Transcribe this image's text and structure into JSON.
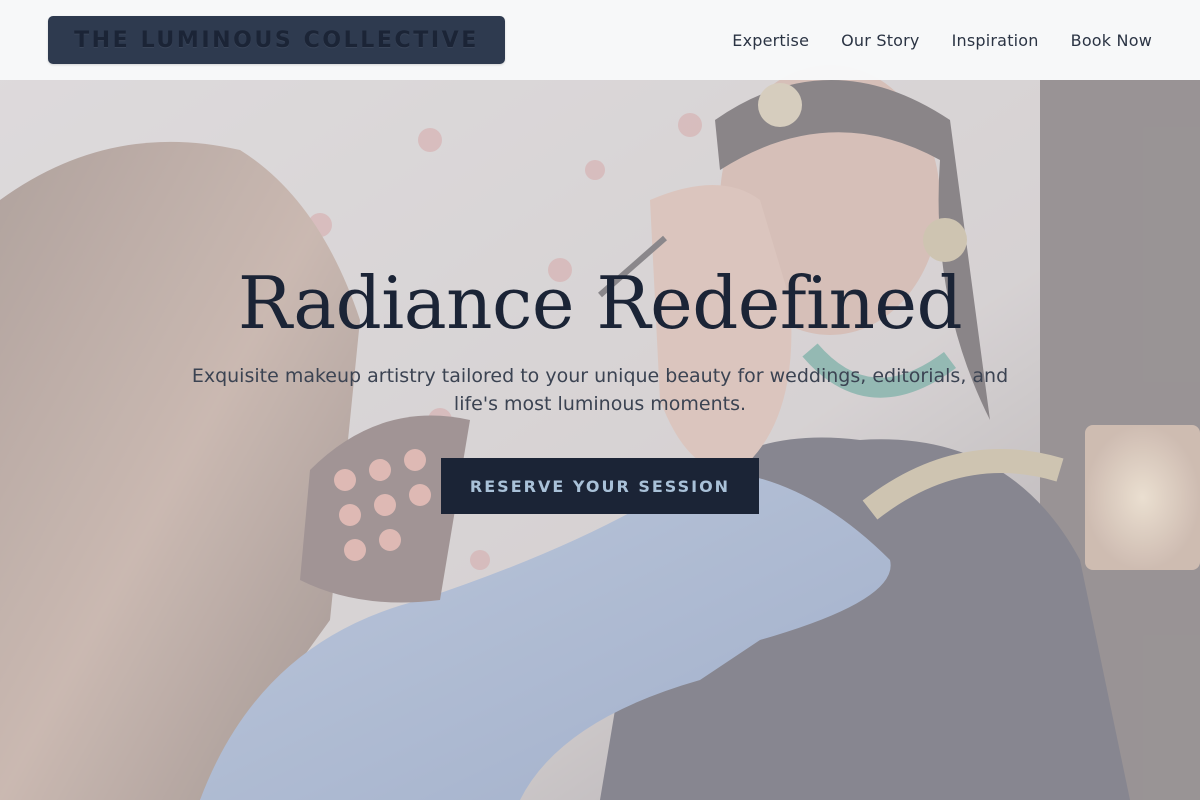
{
  "header": {
    "brand": "THE LUMINOUS COLLECTIVE",
    "nav": [
      {
        "label": "Expertise"
      },
      {
        "label": "Our Story"
      },
      {
        "label": "Inspiration"
      },
      {
        "label": "Book Now"
      }
    ]
  },
  "hero": {
    "title": "Radiance Redefined",
    "subtitle": "Exquisite makeup artistry tailored to your unique beauty for weddings, editorials, and life's most luminous moments.",
    "cta_label": "RESERVE YOUR SESSION",
    "background_image": "makeup-artist-applying-bridal-makeup-photo"
  },
  "colors": {
    "navy": "#1b2436",
    "brand_box": "#2e3a4f",
    "header_bg": "#f8f9fa",
    "cta_text": "#a9c1d8",
    "hero_overlay": "#e2e5ee"
  }
}
